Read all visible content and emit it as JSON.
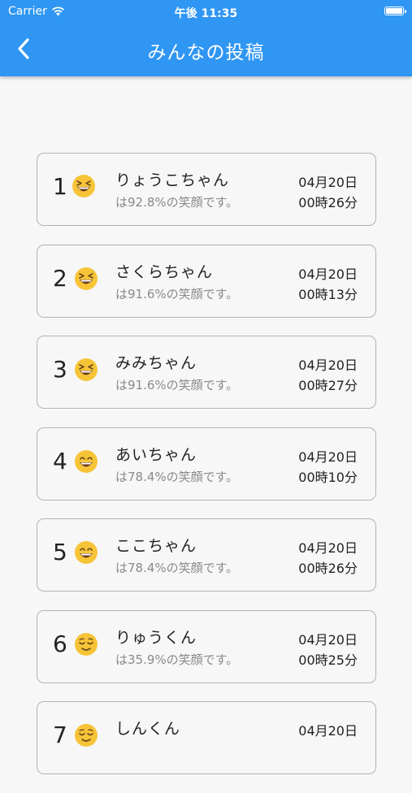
{
  "status_bar": {
    "carrier": "Carrier",
    "time": "午後 11:35",
    "wifi_icon": "wifi-icon",
    "battery_icon": "battery-icon"
  },
  "nav": {
    "title": "みんなの投稿",
    "back_icon": "chevron-left-icon",
    "color": "#2f96f3"
  },
  "posts": [
    {
      "rank": "1",
      "emoji": "laughing-face",
      "name": "りょうこちゃん",
      "smile": "は92.8%の笑顔です。",
      "date": "04月20日",
      "time": "00時26分"
    },
    {
      "rank": "2",
      "emoji": "laughing-face",
      "name": "さくらちゃん",
      "smile": "は91.6%の笑顔です。",
      "date": "04月20日",
      "time": "00時13分"
    },
    {
      "rank": "3",
      "emoji": "laughing-face",
      "name": "みみちゃん",
      "smile": "は91.6%の笑顔です。",
      "date": "04月20日",
      "time": "00時27分"
    },
    {
      "rank": "4",
      "emoji": "grinning-face",
      "name": "あいちゃん",
      "smile": "は78.4%の笑顔です。",
      "date": "04月20日",
      "time": "00時10分"
    },
    {
      "rank": "5",
      "emoji": "grinning-face",
      "name": "ここちゃん",
      "smile": "は78.4%の笑顔です。",
      "date": "04月20日",
      "time": "00時26分"
    },
    {
      "rank": "6",
      "emoji": "relieved-face",
      "name": "りゅうくん",
      "smile": "は35.9%の笑顔です。",
      "date": "04月20日",
      "time": "00時25分"
    },
    {
      "rank": "7",
      "emoji": "relieved-face",
      "name": "しんくん",
      "smile": "",
      "date": "04月20日",
      "time": ""
    }
  ]
}
